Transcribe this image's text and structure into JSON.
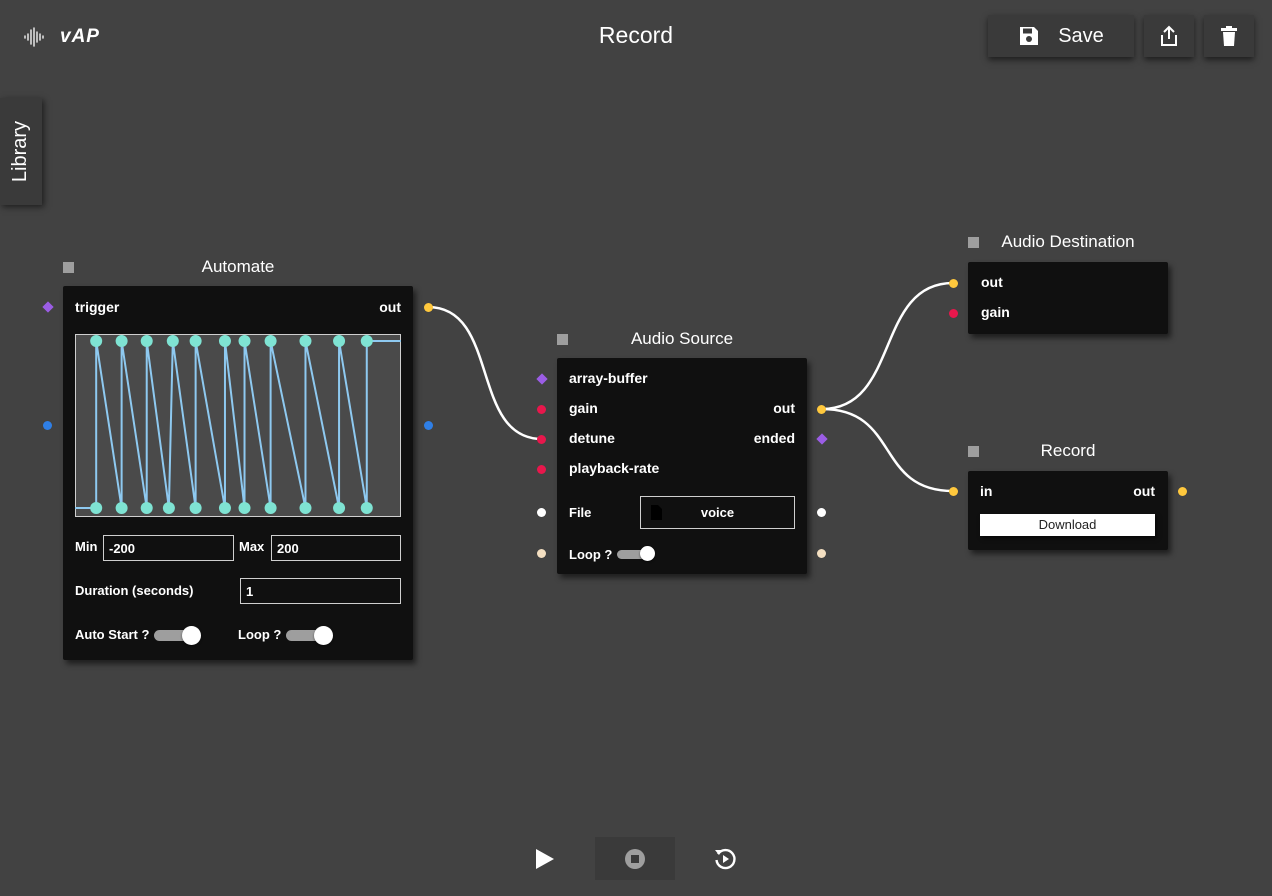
{
  "app": {
    "logo_text": "vAP",
    "title": "Record"
  },
  "toolbar": {
    "save_label": "Save"
  },
  "library": {
    "label": "Library"
  },
  "colors": {
    "background": "#424242",
    "node_bg": "#101010",
    "port_yellow": "#ffc83d",
    "port_red": "#e8174c",
    "port_purple": "#9b5de5",
    "port_blue": "#2f7fe6",
    "port_white": "#ffffff",
    "port_beige": "#f3dfc1",
    "curve": "#7fe3d3",
    "curve_line": "#8ec9f0"
  },
  "automate": {
    "title": "Automate",
    "trigger": "trigger",
    "out": "out",
    "min_label": "Min",
    "min_value": "-200",
    "max_label": "Max",
    "max_value": "200",
    "duration_label": "Duration (seconds)",
    "duration_value": "1",
    "autostart_label": "Auto Start ?",
    "autostart_on": true,
    "loop_label": "Loop ?",
    "loop_on": true,
    "curve_points": [
      {
        "x": 0.0,
        "y": 0.0
      },
      {
        "x": 0.065,
        "y": 0.0
      },
      {
        "x": 0.065,
        "y": 1.0
      },
      {
        "x": 0.143,
        "y": 0.0
      },
      {
        "x": 0.143,
        "y": 1.0
      },
      {
        "x": 0.22,
        "y": 0.0
      },
      {
        "x": 0.22,
        "y": 1.0
      },
      {
        "x": 0.288,
        "y": 0.0
      },
      {
        "x": 0.3,
        "y": 1.0
      },
      {
        "x": 0.37,
        "y": 0.0
      },
      {
        "x": 0.37,
        "y": 1.0
      },
      {
        "x": 0.46,
        "y": 0.0
      },
      {
        "x": 0.46,
        "y": 1.0
      },
      {
        "x": 0.52,
        "y": 0.0
      },
      {
        "x": 0.52,
        "y": 1.0
      },
      {
        "x": 0.6,
        "y": 0.0
      },
      {
        "x": 0.6,
        "y": 1.0
      },
      {
        "x": 0.707,
        "y": 0.0
      },
      {
        "x": 0.707,
        "y": 1.0
      },
      {
        "x": 0.81,
        "y": 0.0
      },
      {
        "x": 0.81,
        "y": 1.0
      },
      {
        "x": 0.895,
        "y": 0.0
      },
      {
        "x": 0.895,
        "y": 1.0
      },
      {
        "x": 1.0,
        "y": 1.0
      }
    ]
  },
  "audio_source": {
    "title": "Audio Source",
    "in_array_buffer": "array-buffer",
    "in_gain": "gain",
    "in_detune": "detune",
    "in_playback_rate": "playback-rate",
    "out_out": "out",
    "out_ended": "ended",
    "file_label": "File",
    "file_value": "voice",
    "loop_label": "Loop ?",
    "loop_on": true
  },
  "audio_destination": {
    "title": "Audio Destination",
    "out": "out",
    "gain": "gain"
  },
  "record": {
    "title": "Record",
    "in": "in",
    "out": "out",
    "download": "Download"
  },
  "transport": {
    "play": "play-icon",
    "stop": "stop-icon",
    "replay": "replay-icon"
  }
}
